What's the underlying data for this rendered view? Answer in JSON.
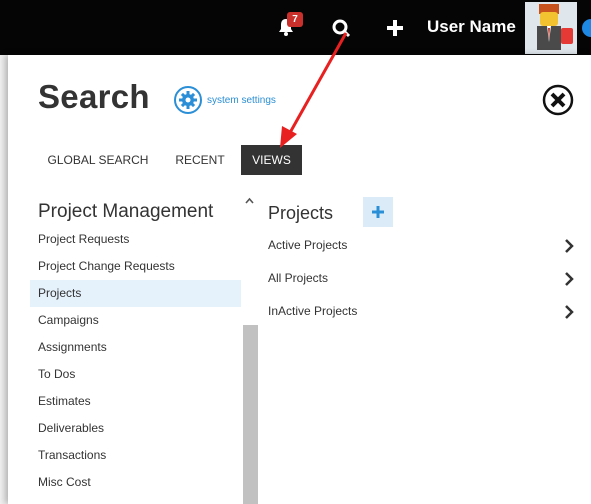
{
  "topbar": {
    "notification_count": "7",
    "user_name": "User Name"
  },
  "panel": {
    "title": "Search",
    "system_settings_label": "system settings"
  },
  "tabs": [
    {
      "label": "GLOBAL SEARCH"
    },
    {
      "label": "RECENT"
    },
    {
      "label": "VIEWS"
    }
  ],
  "sidebar": {
    "title": "Project Management",
    "items": [
      {
        "label": "Project Requests"
      },
      {
        "label": "Project Change Requests"
      },
      {
        "label": "Projects"
      },
      {
        "label": "Campaigns"
      },
      {
        "label": "Assignments"
      },
      {
        "label": "To Dos"
      },
      {
        "label": "Estimates"
      },
      {
        "label": "Deliverables"
      },
      {
        "label": "Transactions"
      },
      {
        "label": "Misc Cost"
      }
    ]
  },
  "content": {
    "title": "Projects",
    "views": [
      {
        "label": "Active Projects"
      },
      {
        "label": "All Projects"
      },
      {
        "label": "InActive Projects"
      }
    ]
  },
  "colors": {
    "topbar": "#050505",
    "accent": "#2a8fd6",
    "active_tab": "#333333",
    "selected_row": "#e5f1fb",
    "badge": "#c9302c",
    "annotation_arrow": "#e82020"
  },
  "icons": [
    "bell-icon",
    "search-icon",
    "plus-icon",
    "gear-icon",
    "close-icon",
    "chevron-right-icon",
    "scroll-up-icon"
  ]
}
